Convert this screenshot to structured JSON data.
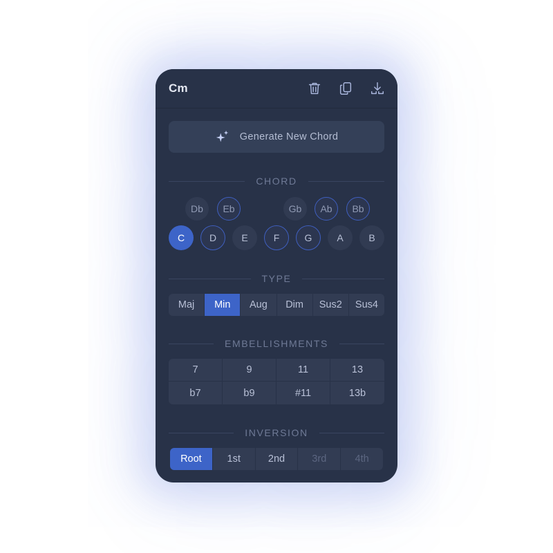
{
  "header": {
    "title": "Cm",
    "icons": [
      "trash-icon",
      "copy-icon",
      "download-icon"
    ]
  },
  "generate": {
    "label": "Generate New Chord",
    "icon": "sparkles-icon"
  },
  "sections": {
    "chord": "CHORD",
    "type": "TYPE",
    "embellishments": "EMBELLISHMENTS",
    "inversion": "INVERSION"
  },
  "chord": {
    "sharps": [
      "Db",
      "Eb",
      "Gb",
      "Ab",
      "Bb"
    ],
    "naturals": [
      "C",
      "D",
      "E",
      "F",
      "G",
      "A",
      "B"
    ],
    "selected_root": "C",
    "chord_tones": [
      "C",
      "Eb",
      "G"
    ]
  },
  "type": {
    "options": [
      "Maj",
      "Min",
      "Aug",
      "Dim",
      "Sus2",
      "Sus4"
    ],
    "selected": "Min"
  },
  "embellishments": {
    "row1": [
      "7",
      "9",
      "11",
      "13"
    ],
    "row2": [
      "b7",
      "b9",
      "#11",
      "13b"
    ]
  },
  "inversion": {
    "options": [
      "Root",
      "1st",
      "2nd",
      "3rd",
      "4th"
    ],
    "selected": "Root",
    "disabled": [
      "3rd",
      "4th"
    ]
  },
  "colors": {
    "background": "#283248",
    "accent": "#3d64c8",
    "ring": "#3f5fbf",
    "icon": "#a9b6dc"
  }
}
